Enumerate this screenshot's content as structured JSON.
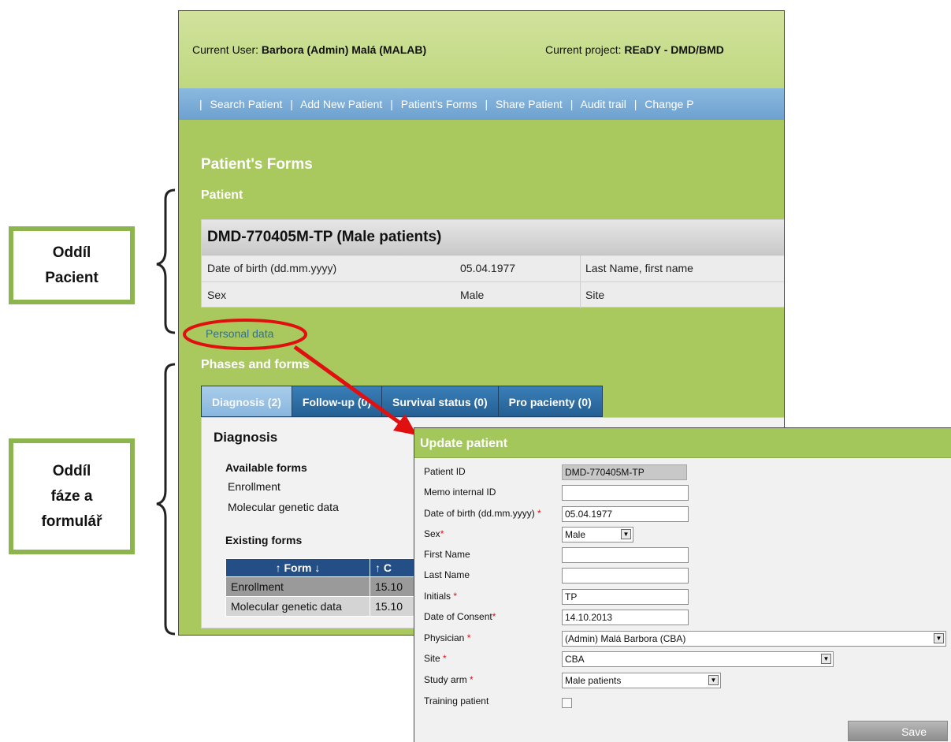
{
  "header": {
    "user_label": "Current User:",
    "user_value": "Barbora (Admin) Malá (MALAB)",
    "project_label": "Current project:",
    "project_value": "REaDY - DMD/BMD"
  },
  "nav": {
    "separator": "|",
    "items": [
      "Search Patient",
      "Add New Patient",
      "Patient's Forms",
      "Share Patient",
      "Audit trail",
      "Change P"
    ]
  },
  "page": {
    "title": "Patient's Forms",
    "patient_heading": "Patient",
    "personal_data_link": "Personal data",
    "phases_heading": "Phases and forms"
  },
  "patient_card": {
    "title": "DMD-770405M-TP (Male patients)",
    "rows": [
      {
        "label": "Date of birth (dd.mm.yyyy)",
        "value": "05.04.1977",
        "label2": "Last Name, first name"
      },
      {
        "label": "Sex",
        "value": "Male",
        "label2": "Site"
      }
    ]
  },
  "tabs": [
    {
      "label": "Diagnosis (2)",
      "active": true
    },
    {
      "label": "Follow-up (0)"
    },
    {
      "label": "Survival status (0)"
    },
    {
      "label": "Pro pacienty (0)"
    }
  ],
  "tab_panel": {
    "title": "Diagnosis",
    "available_heading": "Available forms",
    "available_forms": [
      "Enrollment",
      "Molecular genetic data"
    ],
    "existing_heading": "Existing forms",
    "table_headers": [
      "↑ Form ↓",
      "↑ C"
    ],
    "table_rows": [
      {
        "form": "Enrollment",
        "date": "15.10"
      },
      {
        "form": "Molecular genetic data",
        "date": "15.10"
      }
    ]
  },
  "callouts": {
    "patient": {
      "line1": "Oddíl",
      "line2": "Pacient"
    },
    "phase": {
      "line1": "Oddíl",
      "line2": "fáze a",
      "line3": "formulář"
    }
  },
  "dialog": {
    "title": "Update patient",
    "required_marker": "*",
    "fields": {
      "patient_id": {
        "label": "Patient ID",
        "value": "DMD-770405M-TP"
      },
      "memo_id": {
        "label": "Memo internal ID",
        "value": ""
      },
      "dob": {
        "label": "Date of birth (dd.mm.yyyy)",
        "value": "05.04.1977"
      },
      "sex": {
        "label": "Sex",
        "value": "Male"
      },
      "first_name": {
        "label": "First Name",
        "value": ""
      },
      "last_name": {
        "label": "Last Name",
        "value": ""
      },
      "initials": {
        "label": "Initials",
        "value": "TP"
      },
      "consent": {
        "label": "Date of Consent",
        "value": "14.10.2013"
      },
      "physician": {
        "label": "Physician",
        "value": "(Admin) Malá Barbora (CBA)"
      },
      "site": {
        "label": "Site",
        "value": "CBA"
      },
      "study_arm": {
        "label": "Study arm",
        "value": "Male patients"
      },
      "training": {
        "label": "Training patient",
        "checked": false
      }
    },
    "save_label": "Save"
  },
  "colors": {
    "page_green": "#a9c85e",
    "nav_blue": "#7aaed8",
    "tab_blue": "#2c6aa3",
    "table_header": "#234f86",
    "callout_border": "#8db54e",
    "annotation_red": "#e01010"
  }
}
